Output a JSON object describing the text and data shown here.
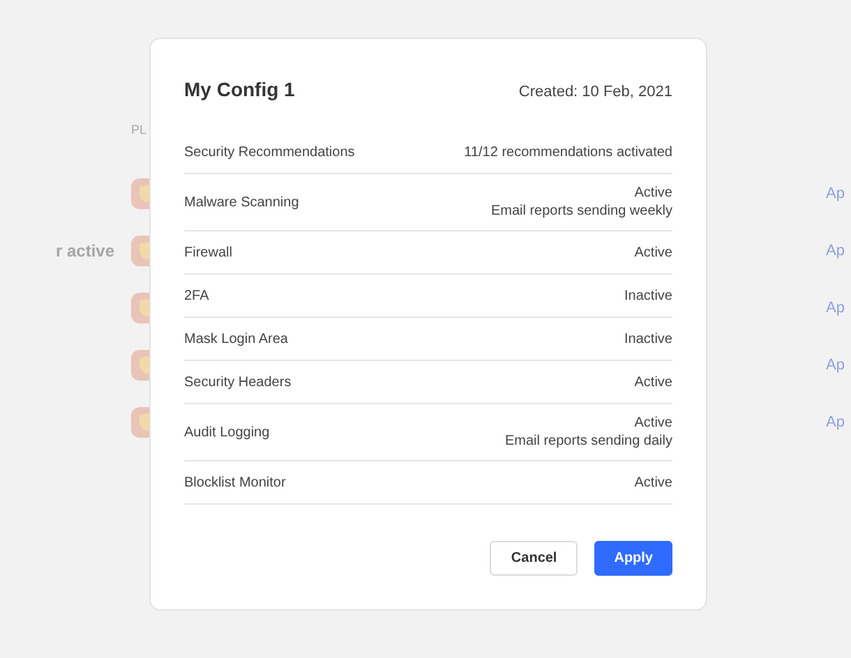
{
  "background": {
    "section_label": "PL",
    "rows": [
      {
        "action": "Ap"
      },
      {
        "label": "r active",
        "action": "Ap"
      },
      {
        "action": "Ap"
      },
      {
        "action": "Ap"
      },
      {
        "action": "Ap"
      }
    ]
  },
  "modal": {
    "title": "My Config 1",
    "created": "Created: 10 Feb, 2021",
    "rows": [
      {
        "name": "Security Recommendations",
        "lines": [
          "11/12 recommendations activated"
        ]
      },
      {
        "name": "Malware Scanning",
        "lines": [
          "Active",
          "Email reports sending weekly"
        ]
      },
      {
        "name": "Firewall",
        "lines": [
          "Active"
        ]
      },
      {
        "name": "2FA",
        "lines": [
          "Inactive"
        ]
      },
      {
        "name": "Mask Login Area",
        "lines": [
          "Inactive"
        ]
      },
      {
        "name": "Security Headers",
        "lines": [
          "Active"
        ]
      },
      {
        "name": "Audit Logging",
        "lines": [
          "Active",
          "Email reports sending daily"
        ]
      },
      {
        "name": "Blocklist Monitor",
        "lines": [
          "Active"
        ]
      }
    ],
    "buttons": [
      {
        "label": "Cancel",
        "kind": "secondary"
      },
      {
        "label": "Apply",
        "kind": "primary"
      }
    ]
  }
}
